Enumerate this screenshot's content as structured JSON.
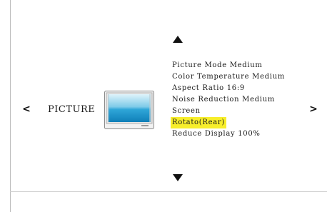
{
  "menu": {
    "category": "PICTURE",
    "nav": {
      "left": "<",
      "right": ">",
      "up_icon": "triangle-up-icon",
      "down_icon": "triangle-down-icon"
    },
    "items": [
      {
        "label": "Picture Mode  Medium",
        "selected": false
      },
      {
        "label": "Color Temperature Medium",
        "selected": false
      },
      {
        "label": "Aspect Ratio 16:9",
        "selected": false
      },
      {
        "label": "Noise Reduction Medium",
        "selected": false
      },
      {
        "label": "Screen",
        "selected": false
      },
      {
        "label": "Rotato(Rear)",
        "selected": true
      },
      {
        "label": "Reduce Display 100%",
        "selected": false
      }
    ],
    "highlight_color": "#f7ee2b"
  }
}
